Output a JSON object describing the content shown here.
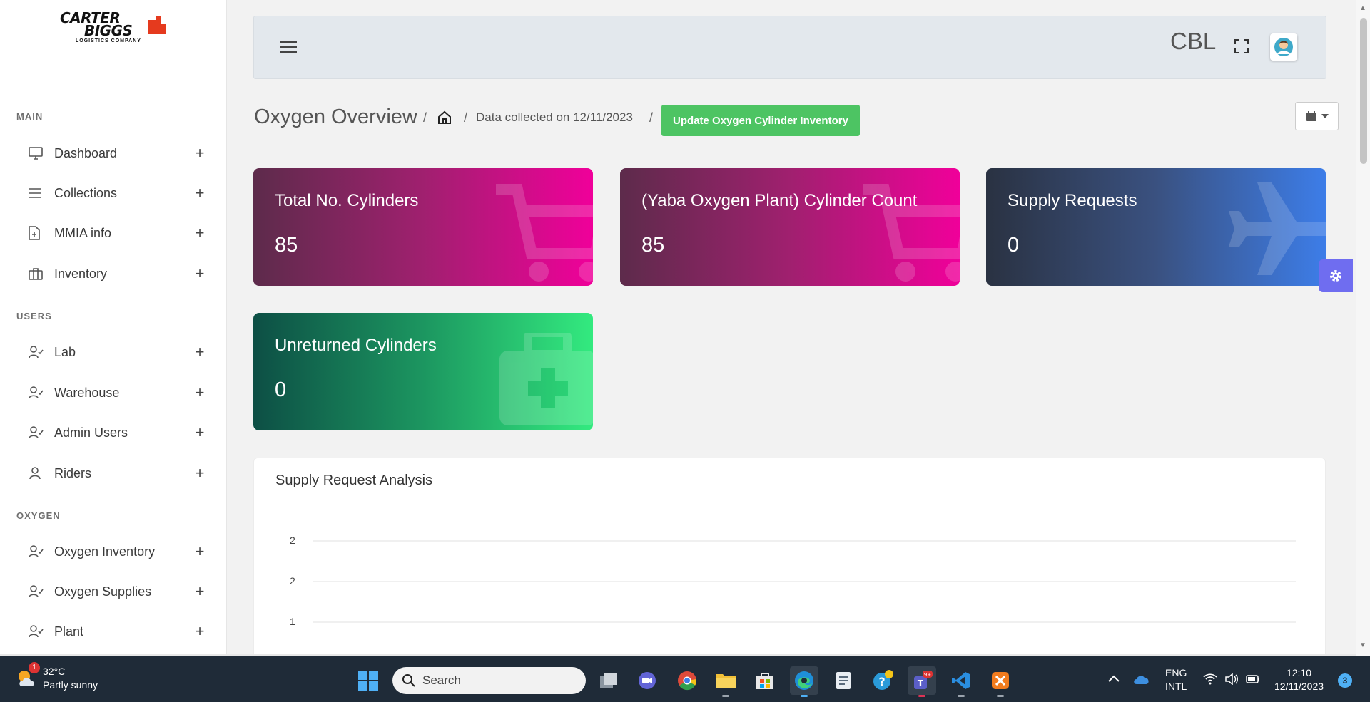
{
  "sidebar": {
    "logo": {
      "line1": "CARTER",
      "line2": "BIGGS",
      "sub": "LOGISTICS COMPANY"
    },
    "sections": {
      "main": "MAIN",
      "users": "USERS",
      "oxygen": "OXYGEN"
    },
    "items": [
      {
        "label": "Dashboard",
        "icon": "monitor-icon"
      },
      {
        "label": "Collections",
        "icon": "list-icon"
      },
      {
        "label": "MMIA info",
        "icon": "file-plus-icon"
      },
      {
        "label": "Inventory",
        "icon": "briefcase-icon"
      },
      {
        "label": "Lab",
        "icon": "user-check-icon"
      },
      {
        "label": "Warehouse",
        "icon": "user-check-icon"
      },
      {
        "label": "Admin Users",
        "icon": "user-check-icon"
      },
      {
        "label": "Riders",
        "icon": "user-icon"
      },
      {
        "label": "Oxygen Inventory",
        "icon": "user-check-icon"
      },
      {
        "label": "Oxygen Supplies",
        "icon": "user-check-icon"
      },
      {
        "label": "Plant",
        "icon": "user-check-icon"
      }
    ],
    "expand_symbol": "+"
  },
  "header": {
    "user_label": "CBL"
  },
  "breadcrumb": {
    "title": "Oxygen Overview",
    "separator": "/",
    "collected": "Data collected on 12/11/2023",
    "update_button": "Update Oxygen Cylinder Inventory"
  },
  "cards": [
    {
      "title": "Total No. Cylinders",
      "value": "85",
      "icon": "cart-icon"
    },
    {
      "title": "(Yaba Oxygen Plant) Cylinder Count",
      "value": "85",
      "icon": "cart-icon"
    },
    {
      "title": "Supply Requests",
      "value": "0",
      "icon": "plane-icon"
    },
    {
      "title": "Unreturned Cylinders",
      "value": "0",
      "icon": "medkit-icon"
    }
  ],
  "chart": {
    "title": "Supply Request Analysis"
  },
  "chart_data": {
    "type": "line",
    "title": "Supply Request Analysis",
    "y_tick_labels": [
      "2",
      "2",
      "1"
    ],
    "grid": true,
    "series": []
  },
  "taskbar": {
    "weather": {
      "temp": "32°C",
      "desc": "Partly sunny",
      "badge": "1"
    },
    "search_placeholder": "Search",
    "teams_badge": "9+",
    "lang_line1": "ENG",
    "lang_line2": "INTL",
    "time": "12:10",
    "date": "12/11/2023",
    "notifications": "3"
  },
  "colors": {
    "accent_green": "#4dc463",
    "card_magenta": "#f0009a",
    "card_blue": "#3d7de8",
    "card_green": "#33ea7f",
    "settings_purple": "#6f6df0"
  }
}
